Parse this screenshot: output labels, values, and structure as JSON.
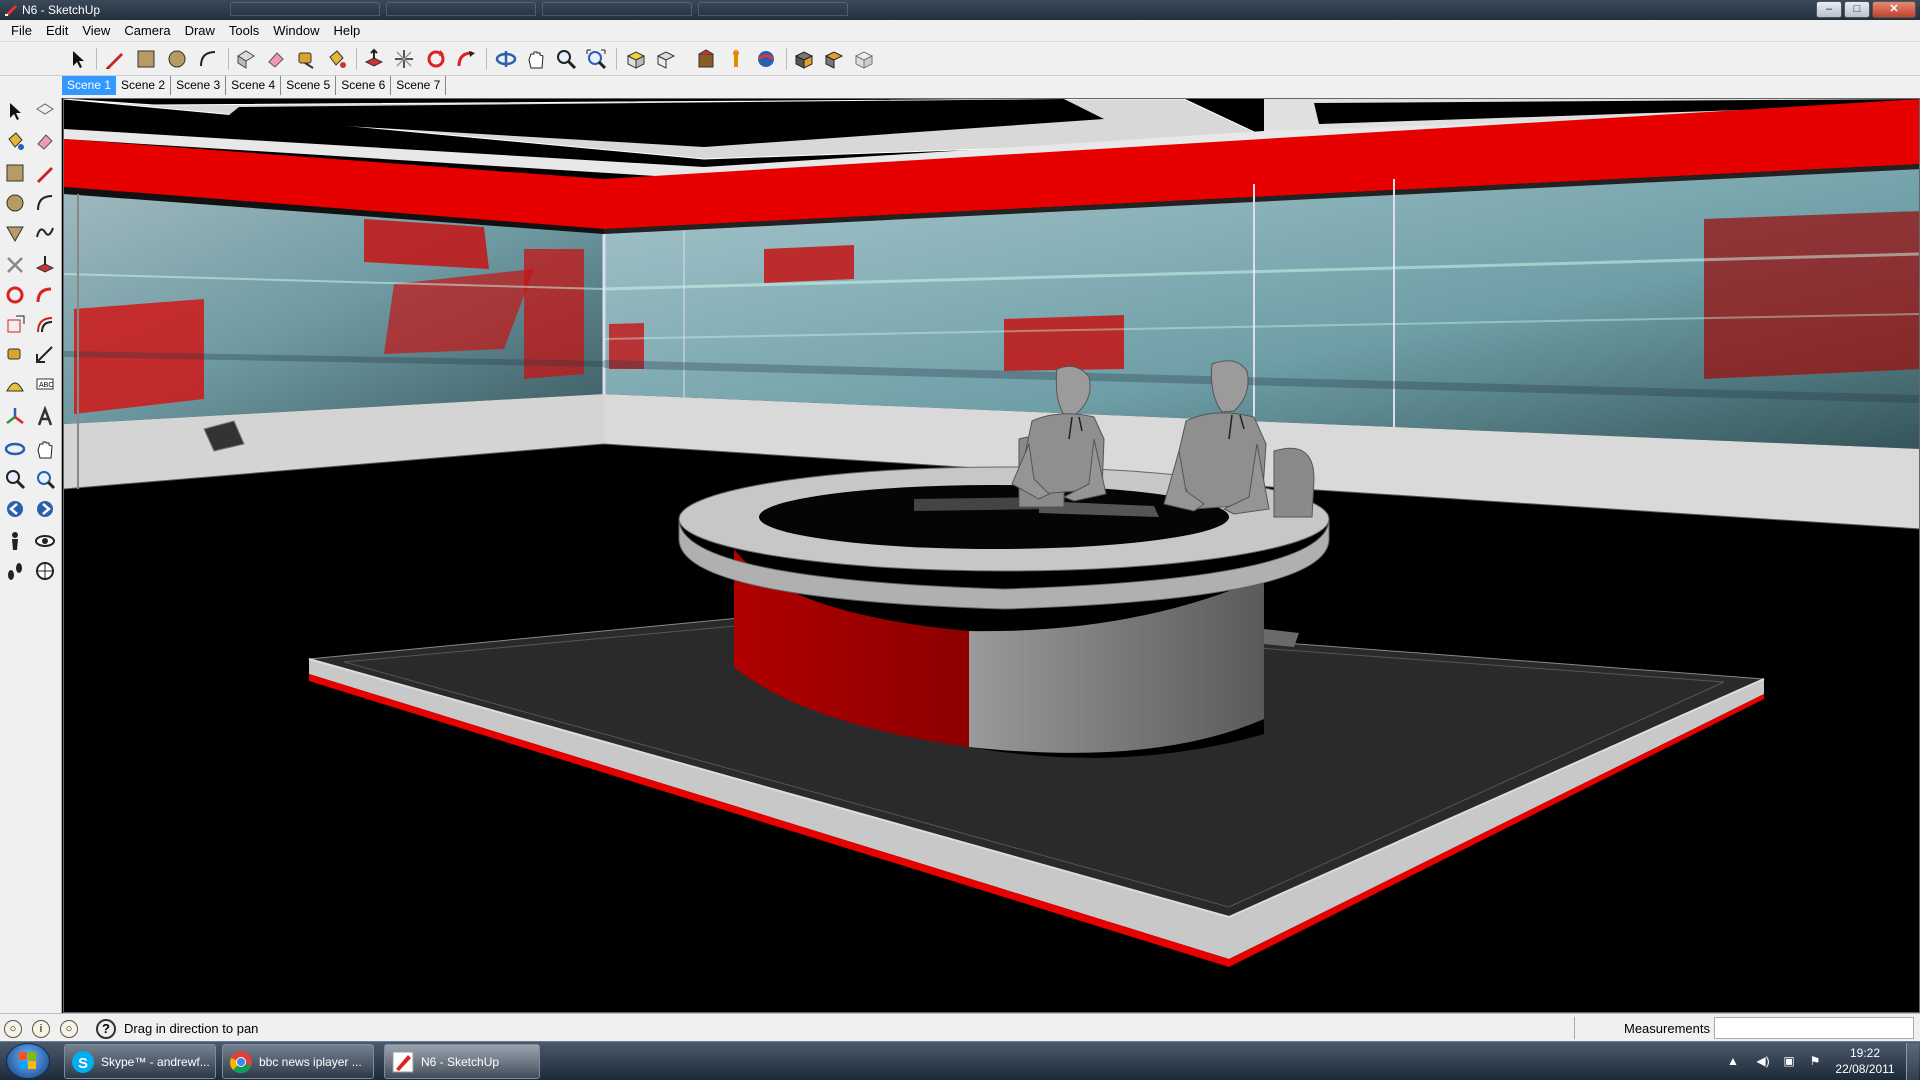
{
  "window": {
    "title": "N6 - SketchUp",
    "controls": [
      "minimize",
      "maximize",
      "close"
    ]
  },
  "menu": [
    "File",
    "Edit",
    "View",
    "Camera",
    "Draw",
    "Tools",
    "Window",
    "Help"
  ],
  "toolbar_icons": [
    "select-icon",
    "line-pencil-icon",
    "rectangle-icon",
    "circle-icon",
    "arc-icon",
    "make-component-icon",
    "eraser-icon",
    "tape-measure-icon",
    "paint-bucket-icon",
    "push-pull-icon",
    "move-icon",
    "rotate-icon",
    "follow-me-icon",
    "orbit-icon",
    "pan-icon",
    "zoom-icon",
    "zoom-extents-icon",
    "iso-view-icon",
    "top-view-icon",
    "front-view-icon",
    "right-view-icon",
    "back-view-icon",
    "geo-location-icon",
    "get-models-icon",
    "share-model-icon",
    "components-icon"
  ],
  "scenes": {
    "tabs": [
      "Scene 1",
      "Scene 2",
      "Scene 3",
      "Scene 4",
      "Scene 5",
      "Scene 6",
      "Scene 7"
    ],
    "active": "Scene 1"
  },
  "left_tools": [
    "select-icon",
    "make-component-icon",
    "paint-bucket-icon",
    "eraser-icon",
    "rectangle-icon",
    "line-pencil-icon",
    "circle-icon",
    "arc-icon",
    "polygon-icon",
    "freehand-icon",
    "move-icon",
    "push-pull-icon",
    "rotate-icon",
    "follow-me-icon",
    "scale-icon",
    "offset-icon",
    "tape-measure-icon",
    "dimension-icon",
    "protractor-icon",
    "text-icon",
    "axes-icon",
    "3d-text-icon",
    "orbit-icon",
    "pan-icon",
    "zoom-icon",
    "zoom-extents-icon",
    "previous-view-icon",
    "next-view-icon",
    "position-camera-icon",
    "look-around-icon",
    "walk-icon",
    "section-plane-icon"
  ],
  "status": {
    "message": "Drag in direction to pan",
    "help": "?",
    "measurements_label": "Measurements",
    "measurements_value": ""
  },
  "taskbar": {
    "tasks": [
      {
        "label": "Skype™ - andrewf...",
        "icon": "skype-icon"
      },
      {
        "label": "bbc news iplayer ...",
        "icon": "chrome-icon"
      },
      {
        "label": "N6 - SketchUp",
        "icon": "sketchup-icon"
      }
    ],
    "clock": {
      "time": "19:22",
      "date": "22/08/2011"
    }
  },
  "colors": {
    "accent_red": "#e60000",
    "dark_red": "#a80000",
    "floor": "#050505",
    "stage": "#2e2e2e",
    "desk_grey": "#bdbdbd",
    "selected_tab": "#3399ff"
  }
}
